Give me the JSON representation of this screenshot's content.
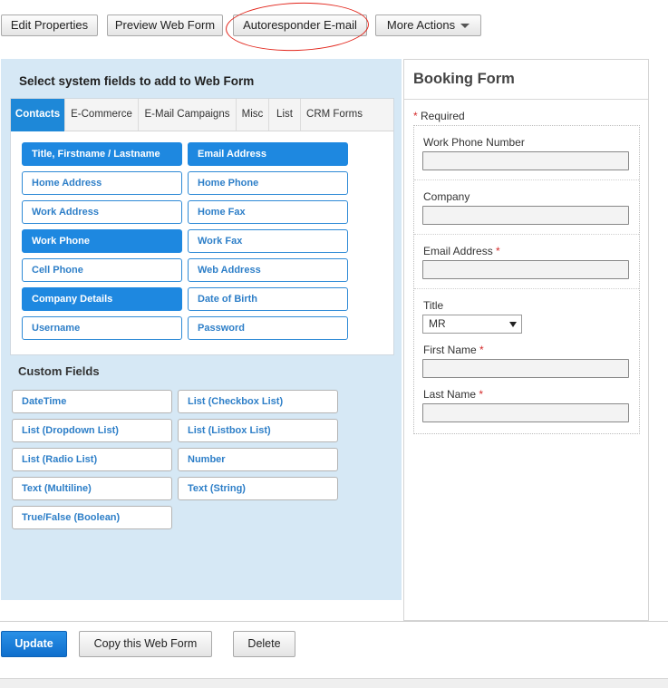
{
  "toolbar": {
    "edit_properties": "Edit Properties",
    "preview_web_form": "Preview Web Form",
    "autoresponder_email": "Autoresponder E-mail",
    "more_actions": "More Actions"
  },
  "system_fields": {
    "title": "Select system fields to add to Web Form",
    "tabs": [
      "Contacts",
      "E-Commerce",
      "E-Mail Campaigns",
      "Misc",
      "List",
      "CRM Forms"
    ],
    "active_tab": "Contacts",
    "fields": [
      {
        "label": "Title, Firstname / Lastname",
        "selected": true
      },
      {
        "label": "Email Address",
        "selected": true
      },
      {
        "label": "Home Address",
        "selected": false
      },
      {
        "label": "Home Phone",
        "selected": false
      },
      {
        "label": "Work Address",
        "selected": false
      },
      {
        "label": "Home Fax",
        "selected": false
      },
      {
        "label": "Work Phone",
        "selected": true
      },
      {
        "label": "Work Fax",
        "selected": false
      },
      {
        "label": "Cell Phone",
        "selected": false
      },
      {
        "label": "Web Address",
        "selected": false
      },
      {
        "label": "Company Details",
        "selected": true
      },
      {
        "label": "Date of Birth",
        "selected": false
      },
      {
        "label": "Username",
        "selected": false
      },
      {
        "label": "Password",
        "selected": false
      }
    ]
  },
  "custom_fields": {
    "title": "Custom Fields",
    "fields": [
      "DateTime",
      "List (Checkbox List)",
      "List (Dropdown List)",
      "List (Listbox List)",
      "List (Radio List)",
      "Number",
      "Text (Multiline)",
      "Text (String)",
      "True/False (Boolean)"
    ]
  },
  "booking_form": {
    "title": "Booking Form",
    "required_note": "Required",
    "required_star": "*",
    "fields": {
      "work_phone": {
        "label": "Work Phone Number",
        "value": ""
      },
      "company": {
        "label": "Company",
        "value": ""
      },
      "email": {
        "label": "Email Address",
        "value": ""
      },
      "title": {
        "label": "Title",
        "value": "MR"
      },
      "first_name": {
        "label": "First Name",
        "value": ""
      },
      "last_name": {
        "label": "Last Name",
        "value": ""
      }
    }
  },
  "actions": {
    "update": "Update",
    "copy": "Copy this Web Form",
    "delete": "Delete"
  },
  "colors": {
    "accent": "#1e88e0",
    "panel_bg": "#d6e8f5",
    "annotation_red": "#e2251b",
    "required_star": "#d42b2b"
  }
}
